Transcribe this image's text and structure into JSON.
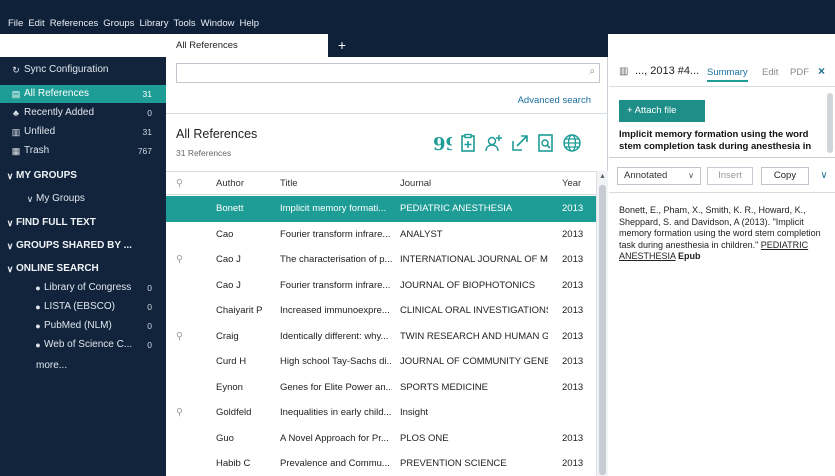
{
  "menu": [
    "File",
    "Edit",
    "References",
    "Groups",
    "Library",
    "Tools",
    "Window",
    "Help"
  ],
  "tabs": {
    "active": "All References",
    "add": "+"
  },
  "sidebar": {
    "sync": "Sync Configuration",
    "items": [
      {
        "label": "All References",
        "count": "31"
      },
      {
        "label": "Recently Added",
        "count": "0"
      },
      {
        "label": "Unfiled",
        "count": "31"
      },
      {
        "label": "Trash",
        "count": "767"
      }
    ],
    "my_groups": "MY GROUPS",
    "my_groups_sub": "My Groups",
    "find_full_text": "FIND FULL TEXT",
    "groups_shared": "GROUPS SHARED BY ...",
    "online_search": "ONLINE SEARCH",
    "online_items": [
      {
        "label": "Library of Congress",
        "count": "0"
      },
      {
        "label": "LISTA (EBSCO)",
        "count": "0"
      },
      {
        "label": "PubMed (NLM)",
        "count": "0"
      },
      {
        "label": "Web of Science C...",
        "count": "0"
      }
    ],
    "more": "more..."
  },
  "center": {
    "advanced_search": "Advanced search",
    "title": "All References",
    "count": "31 References",
    "columns": {
      "author": "Author",
      "title": "Title",
      "journal": "Journal",
      "year": "Year"
    },
    "rows": [
      {
        "author": "Bonett",
        "title": "Implicit memory formati...",
        "journal": "PEDIATRIC ANESTHESIA",
        "year": "2013",
        "clip": false,
        "selected": true
      },
      {
        "author": "Cao",
        "title": "Fourier transform infrare...",
        "journal": "ANALYST",
        "year": "2013",
        "clip": false
      },
      {
        "author": "Cao J",
        "title": "The characterisation of p...",
        "journal": "INTERNATIONAL JOURNAL OF M...",
        "year": "2013",
        "clip": true
      },
      {
        "author": "Cao J",
        "title": "Fourier transform infrare...",
        "journal": "JOURNAL OF BIOPHOTONICS",
        "year": "2013",
        "clip": false
      },
      {
        "author": "Chaiyarit P",
        "title": "Increased immunoexpre...",
        "journal": "CLINICAL ORAL INVESTIGATIONS",
        "year": "2013",
        "clip": false
      },
      {
        "author": "Craig",
        "title": "Identically different: why...",
        "journal": "TWIN RESEARCH AND HUMAN G...",
        "year": "2013",
        "clip": true
      },
      {
        "author": "Curd H",
        "title": "High school Tay-Sachs di...",
        "journal": "JOURNAL OF COMMUNITY GENE...",
        "year": "2013",
        "clip": false
      },
      {
        "author": "Eynon",
        "title": "Genes for Elite Power an...",
        "journal": "SPORTS MEDICINE",
        "year": "2013",
        "clip": false
      },
      {
        "author": "Goldfeld",
        "title": "Inequalities in early child...",
        "journal": "Insight",
        "year": "",
        "clip": true
      },
      {
        "author": "Guo",
        "title": "A Novel Approach for Pr...",
        "journal": "PLOS ONE",
        "year": "2013",
        "clip": false
      },
      {
        "author": "Habib C",
        "title": "Prevalence and Commu...",
        "journal": "PREVENTION SCIENCE",
        "year": "2013",
        "clip": false
      }
    ]
  },
  "right": {
    "ref": "..., 2013 #4...",
    "tabs": {
      "summary": "Summary",
      "edit": "Edit",
      "pdf": "PDF"
    },
    "close": "×",
    "attach": "+ Attach file",
    "title": "Implicit memory formation using the word stem completion task during anesthesia in",
    "style": "Annotated",
    "insert": "Insert",
    "copy": "Copy",
    "citation_text": "Bonett, E., Pham, X., Smith, K. R., Howard, K., Sheppard, S. and Davidson, A (2013). \"Implicit memory formation using the word stem completion task during anesthesia in children.\"",
    "citation_journal": "PEDIATRIC ANESTHESIA",
    "citation_epub": "Epub"
  },
  "colors": {
    "accent": "#1e9d97",
    "sidebar": "#12243c",
    "topbar": "#0f2138",
    "link": "#1b6f9e"
  }
}
